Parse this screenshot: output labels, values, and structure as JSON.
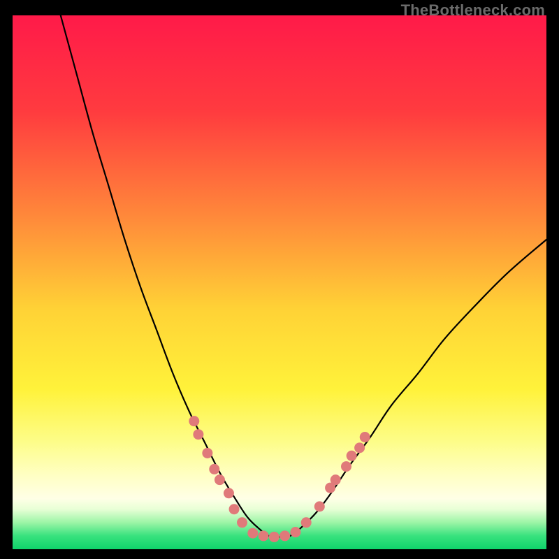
{
  "watermark": "TheBottleneck.com",
  "chart_data": {
    "type": "line",
    "title": "",
    "xlabel": "",
    "ylabel": "",
    "xlim": [
      0,
      100
    ],
    "ylim": [
      0,
      100
    ],
    "grid": false,
    "legend": false,
    "background_gradient": {
      "stops": [
        {
          "offset": 0.0,
          "color": "#ff1a49"
        },
        {
          "offset": 0.18,
          "color": "#ff3b3f"
        },
        {
          "offset": 0.38,
          "color": "#ff8a3a"
        },
        {
          "offset": 0.55,
          "color": "#ffd236"
        },
        {
          "offset": 0.7,
          "color": "#fff23a"
        },
        {
          "offset": 0.8,
          "color": "#fdfd8a"
        },
        {
          "offset": 0.86,
          "color": "#ffffc2"
        },
        {
          "offset": 0.905,
          "color": "#ffffe6"
        },
        {
          "offset": 0.925,
          "color": "#e8ffd6"
        },
        {
          "offset": 0.95,
          "color": "#9cf5a6"
        },
        {
          "offset": 0.975,
          "color": "#38e27e"
        },
        {
          "offset": 1.0,
          "color": "#0fd36b"
        }
      ]
    },
    "series": [
      {
        "name": "bottleneck-curve",
        "color": "#000000",
        "stroke_width": 2.2,
        "x": [
          9,
          12,
          15,
          18,
          21,
          24,
          27,
          30,
          33,
          36,
          39,
          42,
          44,
          46,
          48,
          50,
          52,
          54,
          57,
          60,
          63,
          67,
          71,
          76,
          81,
          87,
          93,
          100
        ],
        "y": [
          100,
          89,
          78,
          68,
          58,
          49,
          41,
          33,
          26,
          20,
          14,
          9,
          6,
          4,
          2.5,
          2.3,
          2.5,
          4,
          7,
          11,
          15.5,
          21,
          27,
          33,
          39.5,
          46,
          52,
          58
        ]
      }
    ],
    "markers": {
      "name": "highlight-dots",
      "color": "#e07a7a",
      "radius": 7.5,
      "points": [
        {
          "x": 34.0,
          "y": 24.0
        },
        {
          "x": 34.8,
          "y": 21.5
        },
        {
          "x": 36.5,
          "y": 18.0
        },
        {
          "x": 37.8,
          "y": 15.0
        },
        {
          "x": 38.8,
          "y": 13.0
        },
        {
          "x": 40.5,
          "y": 10.5
        },
        {
          "x": 41.5,
          "y": 7.5
        },
        {
          "x": 43.0,
          "y": 5.0
        },
        {
          "x": 45.0,
          "y": 3.0
        },
        {
          "x": 47.0,
          "y": 2.5
        },
        {
          "x": 49.0,
          "y": 2.3
        },
        {
          "x": 51.0,
          "y": 2.5
        },
        {
          "x": 53.0,
          "y": 3.2
        },
        {
          "x": 55.0,
          "y": 5.0
        },
        {
          "x": 57.5,
          "y": 8.0
        },
        {
          "x": 59.5,
          "y": 11.5
        },
        {
          "x": 60.5,
          "y": 13.0
        },
        {
          "x": 62.5,
          "y": 15.5
        },
        {
          "x": 63.5,
          "y": 17.5
        },
        {
          "x": 65.0,
          "y": 19.0
        },
        {
          "x": 66.0,
          "y": 21.0
        }
      ]
    }
  }
}
